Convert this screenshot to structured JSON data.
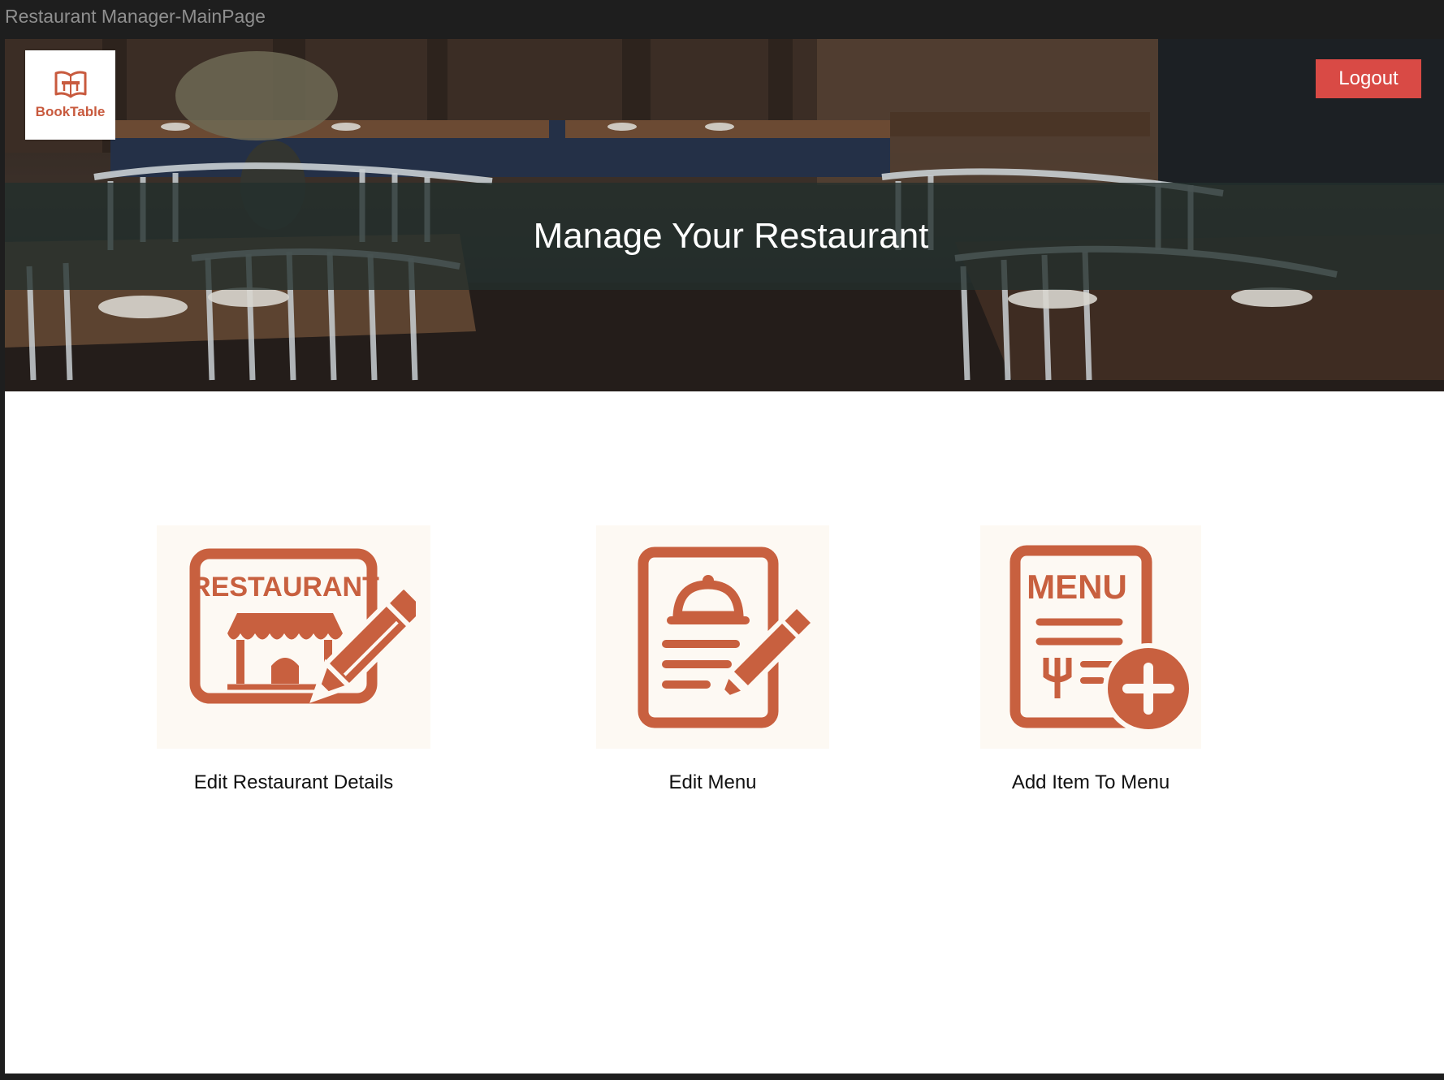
{
  "window": {
    "title": "Restaurant Manager-MainPage"
  },
  "header": {
    "logo_text": "BookTable",
    "logout_label": "Logout",
    "banner_title": "Manage Your Restaurant"
  },
  "actions": [
    {
      "label": "Edit Restaurant Details",
      "icon": "restaurant-edit-icon"
    },
    {
      "label": "Edit Menu",
      "icon": "menu-edit-icon"
    },
    {
      "label": "Add Item To Menu",
      "icon": "menu-add-icon"
    }
  ],
  "icons": {
    "restaurant_sign_text": "RESTAURANT",
    "menu_sign_text": "MENU"
  },
  "colors": {
    "accent": "#c8603f",
    "logout": "#d94a45",
    "tile_bg": "#fdf9f3"
  }
}
